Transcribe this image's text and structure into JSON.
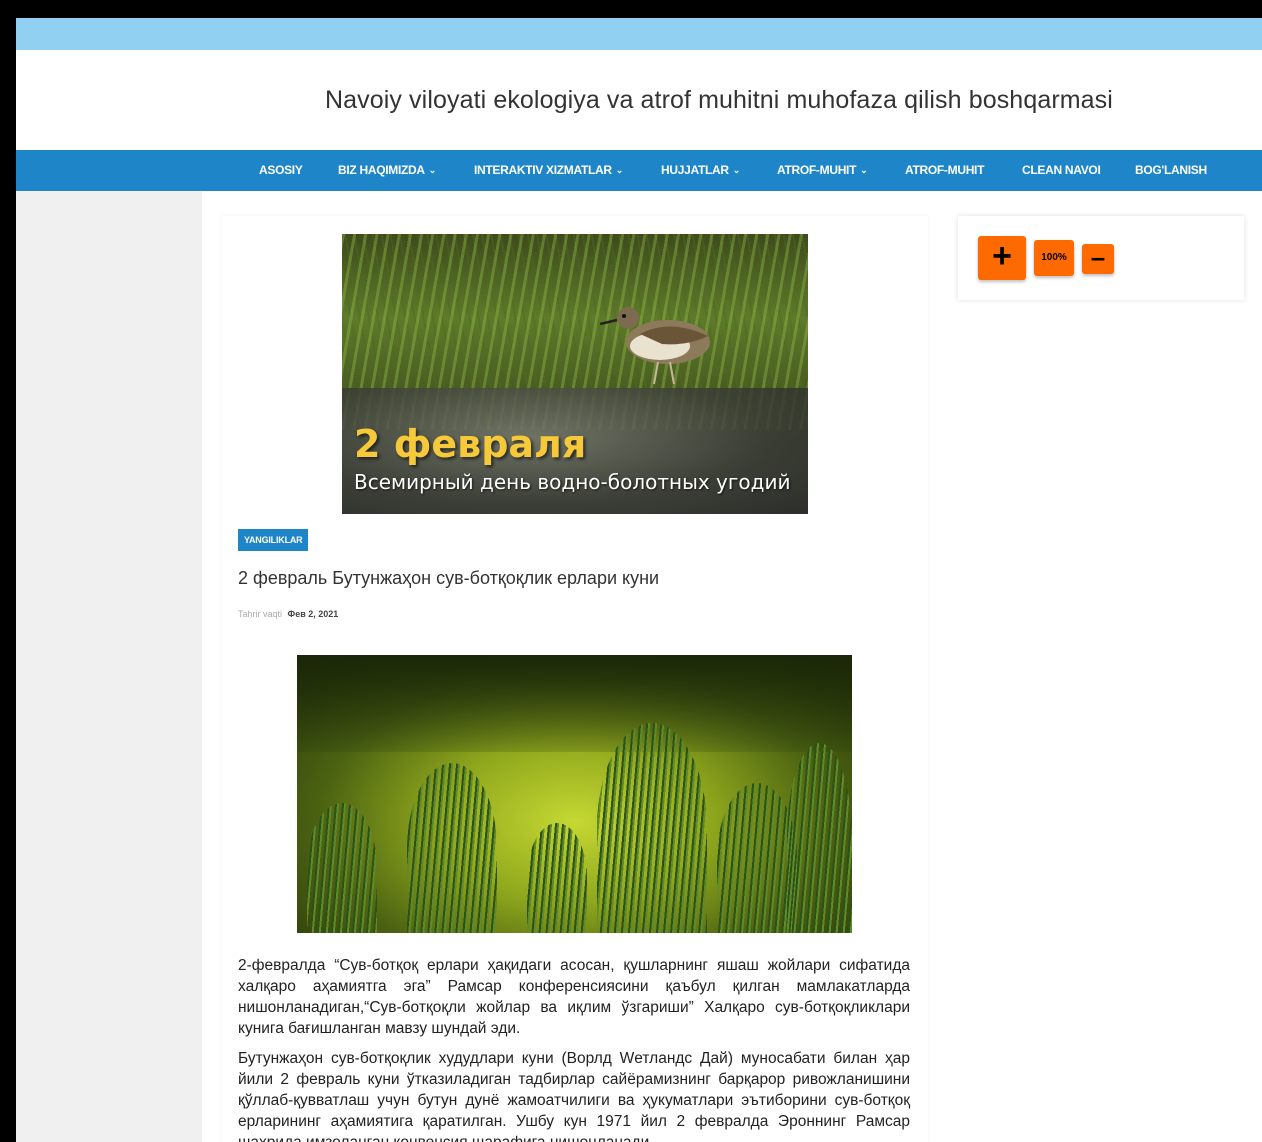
{
  "header": {
    "site_title": "Navoiy viloyati ekologiya va atrof muhitni muhofaza qilish boshqarmasi"
  },
  "nav": {
    "items": [
      {
        "label": "ASOSIY",
        "has_dropdown": false
      },
      {
        "label": "BIZ HAQIMIZDA",
        "has_dropdown": true
      },
      {
        "label": "INTERAKTIV XIZMATLAR",
        "has_dropdown": true
      },
      {
        "label": "HUJJATLAR",
        "has_dropdown": true
      },
      {
        "label": "ATROF-MUHIT",
        "has_dropdown": true
      },
      {
        "label": "ATROF-MUHIT",
        "has_dropdown": false
      },
      {
        "label": "CLEAN NAVOI",
        "has_dropdown": false
      },
      {
        "label": "BOG'LANISH",
        "has_dropdown": false
      }
    ],
    "dropdown_icon": "chevron-down-icon"
  },
  "article": {
    "hero": {
      "title": "2 февраля",
      "subtitle": "Всемирный день водно-болотных угодий"
    },
    "category": "YANGILIKLAR",
    "title": "2 февраль Бутунжаҳон сув-ботқоқлик ерлари куни",
    "meta_label": "Tahrir vaqti",
    "meta_date": "Фев 2, 2021",
    "paragraphs": [
      "2-февралда “Сув-ботқоқ ерлари ҳақидаги асосан, қушларнинг яшаш жойлари сифатида халқаро аҳамиятга эга” Рамсар конференсиясини қаъбул қилган мамлакатларда нишонланадиган,“Сув-ботқоқли жойлар ва иқлим ўзгариши” Халқаро сув-ботқоқликлари кунига бағишланган мавзу шундай эди.",
      "Бутунжаҳон сув-ботқоқлик худудлари куни (Ворлд Wетландс Дай) муносабати билан ҳар йили 2 февраль куни ўтказиладиган тадбирлар сайёрамизнинг барқарор ривожланишини қўллаб-қувватлаш учун бутун дунё жамоатчилиги ва ҳукуматлари эътиборини сув-ботқоқ ерларининг аҳамиятига қаратилган. Ушбу кун 1971 йил 2 февралда Эроннинг Рамсар шаҳрида имзоланган конвенсия шарафига нишонланади."
    ]
  },
  "zoom_widget": {
    "plus_label": "+",
    "level_label": "100%",
    "minus_label": "–",
    "accent_color": "#ff6a00"
  },
  "colors": {
    "topbar": "#92d0f1",
    "navbar": "#1e85c8"
  }
}
